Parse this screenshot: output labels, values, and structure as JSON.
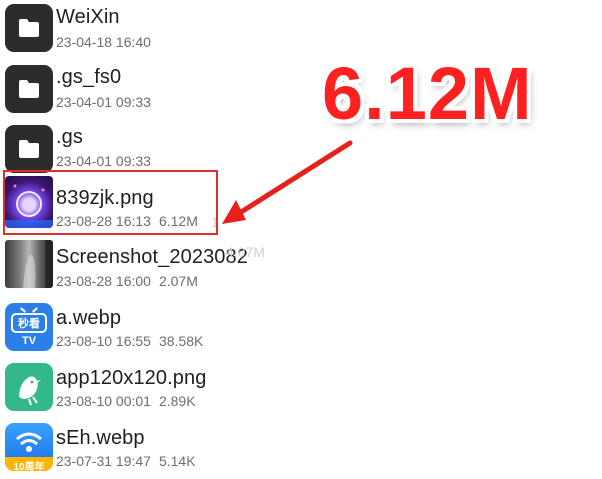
{
  "files": [
    {
      "name": "WeiXin",
      "date": "23-04-18 16:40",
      "size": "",
      "type": "folder",
      "icon": "folder-icon"
    },
    {
      "name": ".gs_fs0",
      "date": "23-04-01 09:33",
      "size": "",
      "type": "folder",
      "icon": "folder-icon"
    },
    {
      "name": ".gs",
      "date": "23-04-01 09:33",
      "size": "",
      "type": "folder",
      "icon": "folder-icon"
    },
    {
      "name": "839zjk.png",
      "date": "23-08-28 16:13",
      "size": "6.12M",
      "type": "image",
      "icon": "image-thumbnail"
    },
    {
      "name": "Screenshot_2023082",
      "date": "23-08-28 16:00",
      "size": "2.07M",
      "type": "image",
      "icon": "screenshot-thumbnail"
    },
    {
      "name": "a.webp",
      "date": "23-08-10 16:55",
      "size": "38.58K",
      "type": "app-icon",
      "icon": "miaokan-tv-icon",
      "icon_text": "秒看",
      "icon_subtext": "TV"
    },
    {
      "name": "app120x120.png",
      "date": "23-08-10 00:01",
      "size": "2.89K",
      "type": "app-icon",
      "icon": "bird-icon"
    },
    {
      "name": "sEh.webp",
      "date": "23-07-31 19:47",
      "size": "5.14K",
      "type": "app-icon",
      "icon": "wifi-anniversary-icon",
      "icon_text": "10周年"
    }
  ],
  "annotation": {
    "label": "6.12M",
    "color": "#ff2020"
  },
  "ghost_text": {
    "size_partial": "4.07M",
    "char_partial": "1"
  }
}
